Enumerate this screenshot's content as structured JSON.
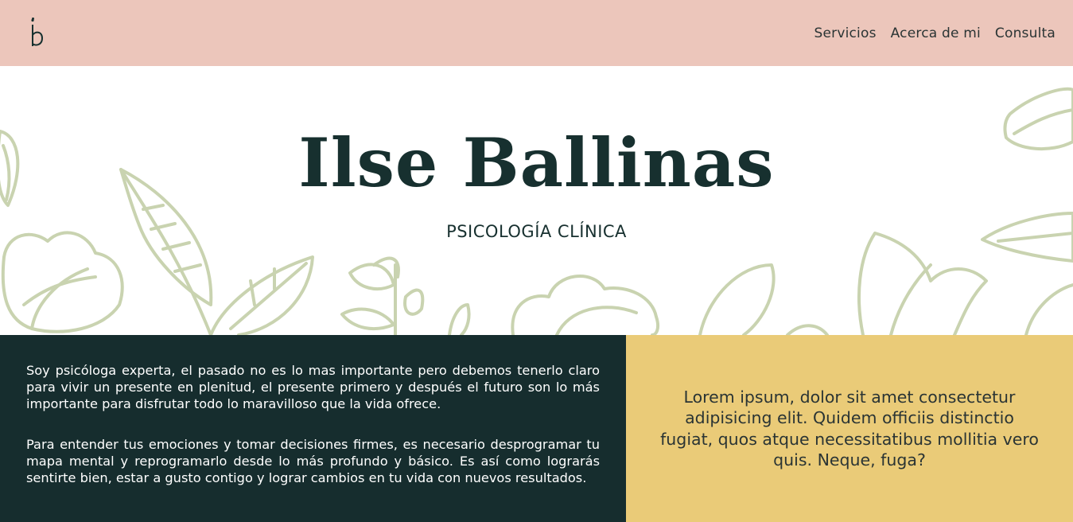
{
  "nav": {
    "logo_text": "ib",
    "links": [
      "Servicios",
      "Acerca de mi",
      "Consulta"
    ]
  },
  "hero": {
    "title": "Ilse Ballinas",
    "subtitle": "PSICOLOGÍA CLÍNICA"
  },
  "about": {
    "paragraph_1": "Soy psicóloga experta, el pasado no es lo mas importante pero debemos tenerlo claro para vivir un presente en plenitud, el presente primero y después el futuro son lo más importante para disfrutar todo lo maravilloso que la vida ofrece.",
    "paragraph_2": "Para entender tus emociones y tomar decisiones firmes, es necesario desprogramar tu mapa mental y reprogramarlo desde lo más profundo y básico. Es así como lograrás sentirte bien, estar a gusto contigo y lograr cambios en tu vida con nuevos resultados."
  },
  "quote": {
    "text": "Lorem ipsum, dolor sit amet consectetur adipisicing elit. Quidem officiis distinctio fugiat, quos atque necessitatibus mollitia vero quis. Neque, fuga?"
  },
  "colors": {
    "nav_bg": "#ecc6bb",
    "dark_green": "#162d2e",
    "mustard": "#eacb78",
    "leaf_stroke": "#c9d3b0"
  },
  "icons": [
    "logo-mark-icon",
    "leaf-illustration"
  ]
}
